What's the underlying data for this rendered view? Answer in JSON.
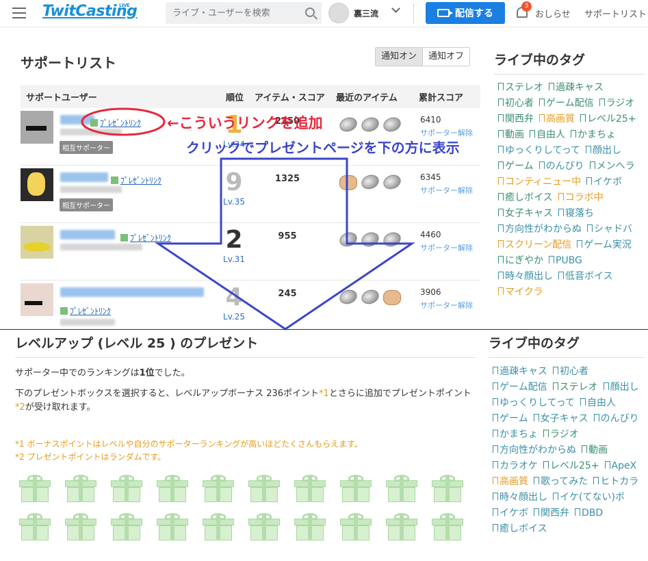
{
  "header": {
    "logo": "TwitCasting",
    "logo_sup": "LIVE",
    "search_placeholder": "ライブ・ユーザーを検索",
    "username": "裏三流",
    "broadcast_label": "配信する",
    "notification_count": "3",
    "notice_label": "おしらせ",
    "support_list_label": "サポートリスト"
  },
  "main": {
    "title": "サポートリスト",
    "toggle_on": "通知オン",
    "toggle_off": "通知オフ",
    "columns": [
      "サポートユーザー",
      "順位",
      "アイテム・スコア",
      "最近のアイテム",
      "累計スコア"
    ],
    "rows": [
      {
        "rank": "1",
        "level": "Lv.34",
        "score": "2350",
        "total": "6410",
        "link": "ﾌﾟﾚｾﾞﾝﾄﾘﾝｸ",
        "mutual": "相互サポーター",
        "unsupport": "サポーター解除"
      },
      {
        "rank": "9",
        "level": "Lv.35",
        "score": "1325",
        "total": "6345",
        "link": "ﾌﾟﾚｾﾞﾝﾄﾘﾝｸ",
        "mutual": "相互サポーター",
        "unsupport": "サポーター解除"
      },
      {
        "rank": "2",
        "level": "Lv.31",
        "score": "955",
        "total": "4460",
        "link": "ﾌﾟﾚｾﾞﾝﾄﾘﾝｸ",
        "mutual": "",
        "unsupport": "サポーター解除"
      },
      {
        "rank": "4",
        "level": "Lv.25",
        "score": "245",
        "total": "3906",
        "link": "ﾌﾟﾚｾﾞﾝﾄﾘﾝｸ",
        "mutual": "",
        "unsupport": "サポーター解除"
      }
    ]
  },
  "annotations": {
    "red": "←こういうリンクを追加",
    "blue": "クリックでプレゼントページを下の方に表示"
  },
  "sidebar_top": {
    "title": "ライブ中のタグ",
    "tags": [
      {
        "t": "ステレオ",
        "c": "green"
      },
      {
        "t": "過疎キャス",
        "c": "green"
      },
      {
        "t": "初心者",
        "c": "green"
      },
      {
        "t": "ゲーム配信",
        "c": "green"
      },
      {
        "t": "ラジオ",
        "c": "green"
      },
      {
        "t": "関西弁",
        "c": "green"
      },
      {
        "t": "高画質",
        "c": "orange"
      },
      {
        "t": "レベル25+",
        "c": "green"
      },
      {
        "t": "動画",
        "c": "green"
      },
      {
        "t": "自由人",
        "c": "green"
      },
      {
        "t": "かまちょ",
        "c": "green"
      },
      {
        "t": "ゆっくりしてって",
        "c": "blue"
      },
      {
        "t": "顔出し",
        "c": "blue"
      },
      {
        "t": "ゲーム",
        "c": "green"
      },
      {
        "t": "のんびり",
        "c": "blue"
      },
      {
        "t": "メンヘラ",
        "c": "green"
      },
      {
        "t": "コンティニュー中",
        "c": "orange"
      },
      {
        "t": "イケボ",
        "c": "blue"
      },
      {
        "t": "癒しボイス",
        "c": "green"
      },
      {
        "t": "コラボ中",
        "c": "orange"
      },
      {
        "t": "女子キャス",
        "c": "green"
      },
      {
        "t": "寝落ち",
        "c": "blue"
      },
      {
        "t": "方向性がわからぬ",
        "c": "blue"
      },
      {
        "t": "シャドバ",
        "c": "blue"
      },
      {
        "t": "スクリーン配信",
        "c": "orange"
      },
      {
        "t": "ゲーム実況",
        "c": "blue"
      },
      {
        "t": "にぎやか",
        "c": "green"
      },
      {
        "t": "PUBG",
        "c": "blue"
      },
      {
        "t": "時々顔出し",
        "c": "blue"
      },
      {
        "t": "低音ボイス",
        "c": "blue"
      },
      {
        "t": "マイクラ",
        "c": "orange"
      }
    ]
  },
  "present": {
    "title": "レベルアップ (レベル 25 ) のプレゼント",
    "ranking_pre": "サポーター中でのランキングは",
    "ranking_val": "1位",
    "ranking_post": "でした。",
    "desc_1": "下のプレゼントボックスを選択すると、レベルアップボーナス 236ポイント",
    "mark1": "*1",
    "desc_2": "とさらに追加でプレゼントポイント",
    "mark2": "*2",
    "desc_3": "が受け取れます。",
    "note1": "*1 ボーナスポイントはレベルや自分のサポーターランキングが高いほどたくさんもらえます。",
    "note2": "*2 プレゼントポイントはランダムです。",
    "box_count": 20
  },
  "sidebar_bottom": {
    "title": "ライブ中のタグ",
    "tags": [
      {
        "t": "過疎キャス",
        "c": "blue"
      },
      {
        "t": "初心者",
        "c": "blue"
      },
      {
        "t": "ゲーム配信",
        "c": "blue"
      },
      {
        "t": "ステレオ",
        "c": "green"
      },
      {
        "t": "顔出し",
        "c": "blue"
      },
      {
        "t": "ゆっくりしてって",
        "c": "blue"
      },
      {
        "t": "自由人",
        "c": "blue"
      },
      {
        "t": "ゲーム",
        "c": "blue"
      },
      {
        "t": "女子キャス",
        "c": "blue"
      },
      {
        "t": "のんびり",
        "c": "blue"
      },
      {
        "t": "かまちょ",
        "c": "blue"
      },
      {
        "t": "ラジオ",
        "c": "green"
      },
      {
        "t": "方向性がわからぬ",
        "c": "blue"
      },
      {
        "t": "動画",
        "c": "green"
      },
      {
        "t": "カラオケ",
        "c": "blue"
      },
      {
        "t": "レベル25+",
        "c": "green"
      },
      {
        "t": "ApeX",
        "c": "blue"
      },
      {
        "t": "高画質",
        "c": "orange"
      },
      {
        "t": "歌ってみた",
        "c": "blue"
      },
      {
        "t": "ヒトカラ",
        "c": "blue"
      },
      {
        "t": "時々顔出し",
        "c": "blue"
      },
      {
        "t": "イケ(てない)ボ",
        "c": "blue"
      },
      {
        "t": "イケボ",
        "c": "blue"
      },
      {
        "t": "関西弁",
        "c": "blue"
      },
      {
        "t": "DBD",
        "c": "blue"
      },
      {
        "t": "癒しボイス",
        "c": "blue"
      }
    ]
  }
}
